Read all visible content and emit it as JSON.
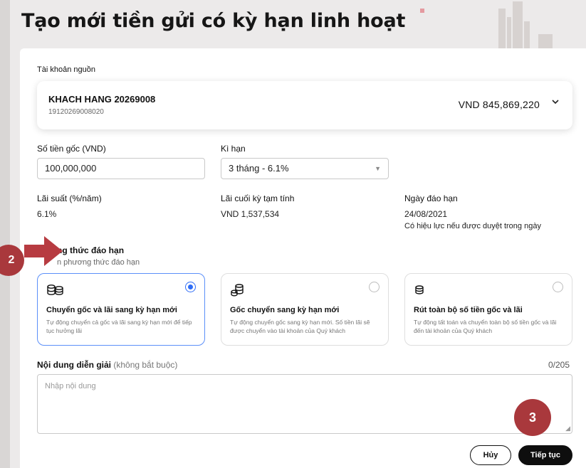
{
  "page": {
    "title": "Tạo mới tiền gửi có kỳ hạn linh hoạt"
  },
  "source_account": {
    "label": "Tài khoản nguồn",
    "name": "KHACH HANG 20269008",
    "number": "19120269008020",
    "balance": "VND  845,869,220",
    "expand_icon": "chevron-down-icon"
  },
  "principal": {
    "label": "Số tiền gốc (VND)",
    "value": "100,000,000"
  },
  "term": {
    "label": "Kì hạn",
    "value": "3 tháng - 6.1%"
  },
  "interest_rate": {
    "label": "Lãi suất (%/năm)",
    "value": "6.1%"
  },
  "estimated_interest": {
    "label": "Lãi cuối kỳ tạm tính",
    "value": "VND 1,537,534"
  },
  "maturity_date": {
    "label": "Ngày đáo hạn",
    "value": "24/08/2021",
    "note": "Có hiệu lực nếu được duyệt trong ngày"
  },
  "maturity_method": {
    "label": "ng thức đáo hạn",
    "hint": "n phương thức đáo hạn",
    "options": [
      {
        "title": "Chuyển gốc và lãi sang kỳ hạn mới",
        "desc": "Tự động chuyển cả gốc và lãi sang kỳ hạn mới để tiếp tục hưởng lãi",
        "selected": true,
        "icon": "coins-stack-icon"
      },
      {
        "title": "Gốc chuyển sang kỳ hạn mới",
        "desc": "Tự động chuyển gốc sang kỳ hạn mới. Số tiền lãi sẽ được chuyển vào tài khoản của Quý khách",
        "selected": false,
        "icon": "coins-icon"
      },
      {
        "title": "Rút toàn bộ số tiền gốc và lãi",
        "desc": "Tự động tất toán và chuyển toàn bộ số tiền gốc và lãi đến tài khoản của Quý khách",
        "selected": false,
        "icon": "coin-icon"
      }
    ]
  },
  "description": {
    "label": "Nội dung diễn giải",
    "optional": "(không bắt buộc)",
    "counter": "0/205",
    "placeholder": "Nhập nội dung"
  },
  "actions": {
    "cancel": "Hủy",
    "next": "Tiếp tục"
  },
  "annotations": {
    "step_2": "2",
    "step_3": "3",
    "badge_color": "#a9383c"
  }
}
